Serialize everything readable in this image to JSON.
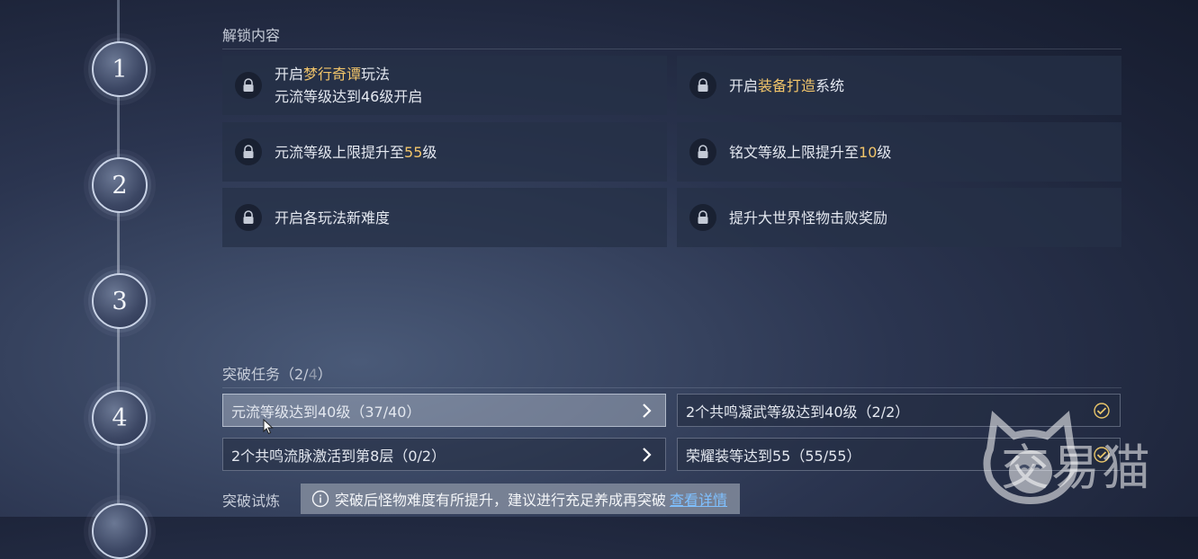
{
  "stages": [
    "1",
    "2",
    "3",
    "4"
  ],
  "unlock": {
    "title": "解锁内容",
    "items": [
      {
        "pre": "开启",
        "hl": "梦行奇谭",
        "post": "玩法",
        "line2": "元流等级达到46级开启"
      },
      {
        "pre": "开启",
        "hl": "装备打造",
        "post": "系统",
        "line2": ""
      },
      {
        "pre": "元流等级上限提升至",
        "hl": "55",
        "post": "级",
        "line2": ""
      },
      {
        "pre": "铭文等级上限提升至",
        "hl": "10",
        "post": "级",
        "line2": ""
      },
      {
        "pre": "开启各玩法新难度",
        "hl": "",
        "post": "",
        "line2": ""
      },
      {
        "pre": "提升大世界怪物击败奖励",
        "hl": "",
        "post": "",
        "line2": ""
      }
    ]
  },
  "tasks": {
    "title_pre": "突破任务（2/",
    "title_total": "4",
    "title_post": "）",
    "items": [
      {
        "label": "元流等级达到40级（37/40）",
        "state": "arrow"
      },
      {
        "label": "2个共鸣凝武等级达到40级（2/2）",
        "state": "done"
      },
      {
        "label": "2个共鸣流脉激活到第8层（0/2）",
        "state": "arrow"
      },
      {
        "label": "荣耀装等达到55（55/55）",
        "state": "done"
      }
    ]
  },
  "trial": {
    "title": "突破试炼",
    "tooltip": "突破后怪物难度有所提升，建议进行充足养成再突破",
    "link": "查看详情"
  },
  "watermark": "交易猫",
  "colors": {
    "highlight": "#f2c56a",
    "link": "#7fc0ff",
    "check": "#e8c56a"
  }
}
